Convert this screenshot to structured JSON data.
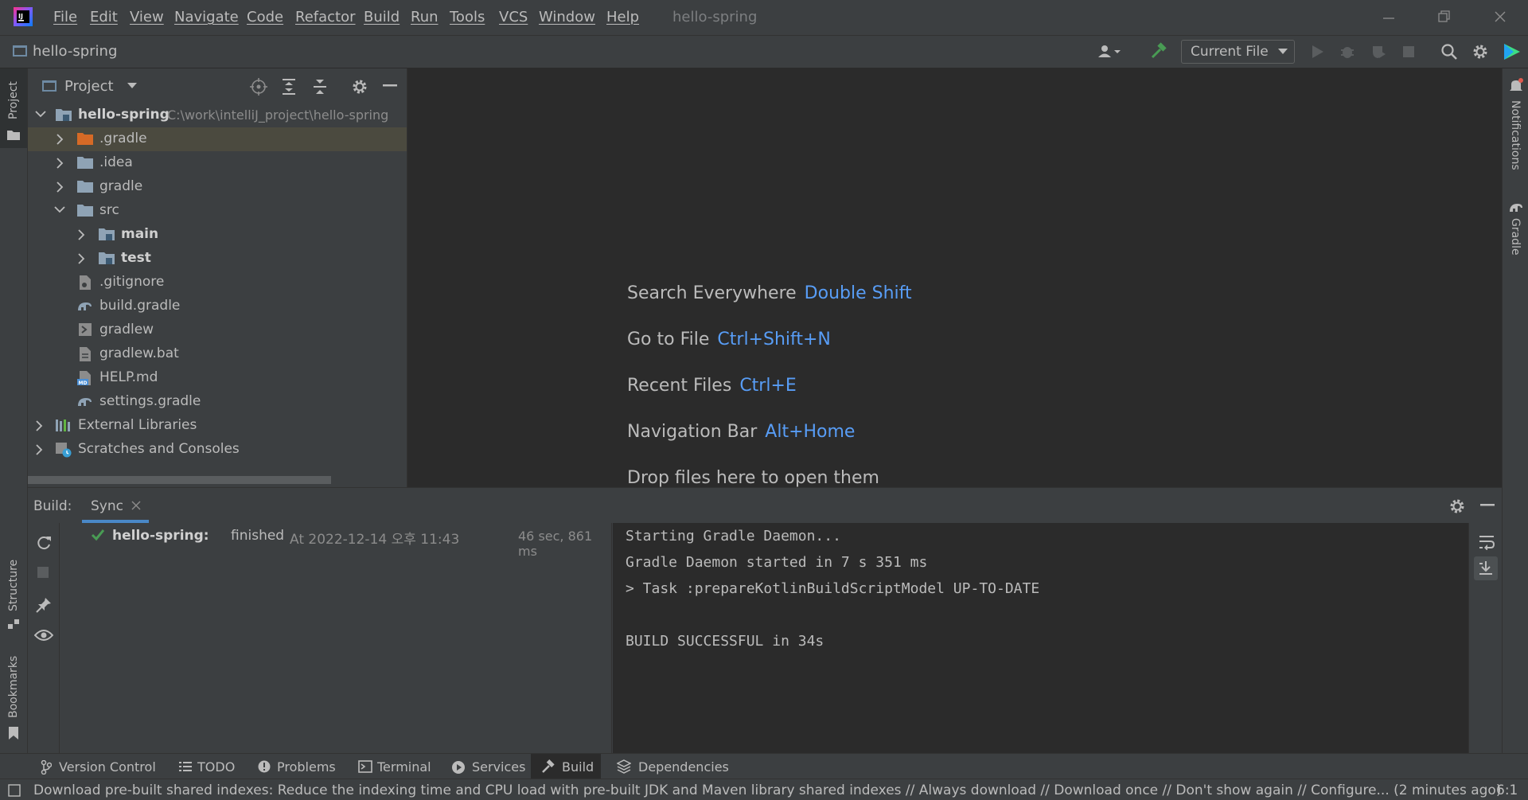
{
  "menu": {
    "items": [
      "File",
      "Edit",
      "View",
      "Navigate",
      "Code",
      "Refactor",
      "Build",
      "Run",
      "Tools",
      "VCS",
      "Window",
      "Help"
    ],
    "window_title": "hello-spring"
  },
  "navbar": {
    "project_name": "hello-spring",
    "run_config": "Current File"
  },
  "stripes": {
    "left_top": "Project",
    "left_structure": "Structure",
    "left_bookmarks": "Bookmarks",
    "right_notifications": "Notifications",
    "right_gradle": "Gradle"
  },
  "project": {
    "header": "Project",
    "root": {
      "name": "hello-spring",
      "path": "C:\\work\\intelliJ_project\\hello-spring"
    },
    "items": [
      {
        "name": ".gradle"
      },
      {
        "name": ".idea"
      },
      {
        "name": "gradle"
      },
      {
        "name": "src"
      },
      {
        "name": "main"
      },
      {
        "name": "test"
      },
      {
        "name": ".gitignore"
      },
      {
        "name": "build.gradle"
      },
      {
        "name": "gradlew"
      },
      {
        "name": "gradlew.bat"
      },
      {
        "name": "HELP.md"
      },
      {
        "name": "settings.gradle"
      },
      {
        "name": "External Libraries"
      },
      {
        "name": "Scratches and Consoles"
      }
    ]
  },
  "editor": {
    "hints": [
      {
        "label": "Search Everywhere",
        "key": "Double Shift"
      },
      {
        "label": "Go to File",
        "key": "Ctrl+Shift+N"
      },
      {
        "label": "Recent Files",
        "key": "Ctrl+E"
      },
      {
        "label": "Navigation Bar",
        "key": "Alt+Home"
      }
    ],
    "drop_hint": "Drop files here to open them"
  },
  "build": {
    "title": "Build:",
    "tab": "Sync",
    "result": {
      "project": "hello-spring:",
      "status": "finished",
      "time": "At 2022-12-14 오후 11:43",
      "duration": "46 sec, 861 ms"
    },
    "console": [
      "Starting Gradle Daemon...",
      "Gradle Daemon started in 7 s 351 ms",
      "> Task :prepareKotlinBuildScriptModel UP-TO-DATE",
      "",
      "BUILD SUCCESSFUL in 34s"
    ]
  },
  "bottom_tabs": [
    "Version Control",
    "TODO",
    "Problems",
    "Terminal",
    "Services",
    "Build",
    "Dependencies"
  ],
  "status": {
    "message": "Download pre-built shared indexes: Reduce the indexing time and CPU load with pre-built JDK and Maven library shared indexes // Always download // Download once // Don't show again // Configure... (2 minutes ago)",
    "position": "6:1"
  },
  "colors": {
    "background": "#2b2b2b",
    "panel": "#3c3f41",
    "accent_key": "#589df6",
    "success": "#499c54",
    "selection": "#4b4a3f"
  }
}
